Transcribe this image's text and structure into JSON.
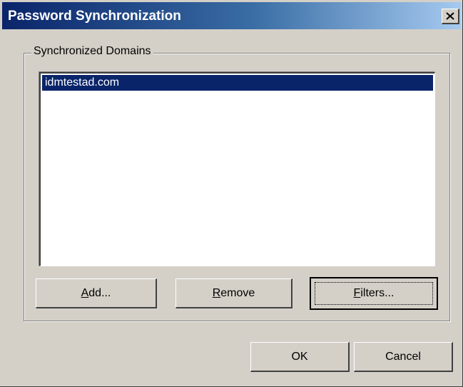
{
  "window": {
    "title": "Password Synchronization",
    "close_label": "Close"
  },
  "group": {
    "label": "Synchronized Domains"
  },
  "domains": {
    "items": [
      {
        "label": "idmtestad.com",
        "selected": true
      }
    ]
  },
  "buttons": {
    "add": {
      "mnemonic": "A",
      "rest": "dd..."
    },
    "remove": {
      "mnemonic": "R",
      "rest": "emove"
    },
    "filters": {
      "mnemonic": "F",
      "rest": "ilters..."
    },
    "ok": "OK",
    "cancel": "Cancel"
  },
  "colors": {
    "dialog_face": "#d4d0c8",
    "title_gradient_start": "#0a246a",
    "title_gradient_end": "#a6caf0",
    "selection": "#0a246a"
  }
}
